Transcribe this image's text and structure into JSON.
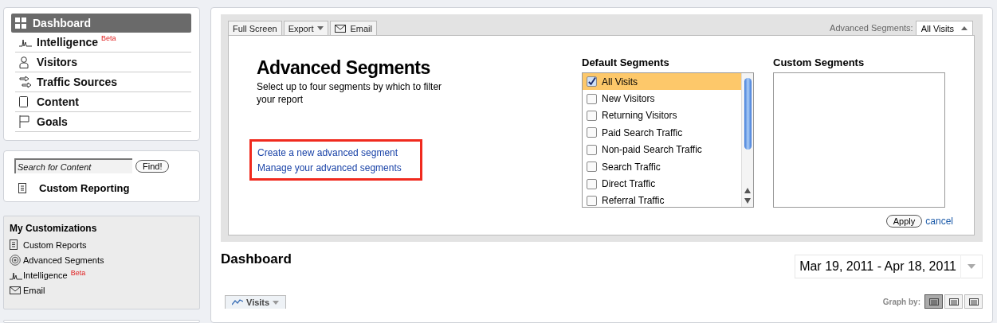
{
  "nav": [
    {
      "label": "Dashboard",
      "kind": "grid",
      "selected": true
    },
    {
      "label": "Intelligence",
      "kind": "spark",
      "badge": "Beta",
      "selected": false
    },
    {
      "label": "Visitors",
      "kind": "person",
      "selected": false
    },
    {
      "label": "Traffic Sources",
      "kind": "arrows",
      "selected": false
    },
    {
      "label": "Content",
      "kind": "page",
      "selected": false
    },
    {
      "label": "Goals",
      "kind": "flag",
      "selected": false
    }
  ],
  "search": {
    "placeholder": "Search for Content",
    "button": "Find!",
    "custom_reporting": "Custom Reporting"
  },
  "customizations": {
    "title": "My Customizations",
    "items": [
      {
        "label": "Custom Reports",
        "kind": "report"
      },
      {
        "label": "Advanced Segments",
        "kind": "target"
      },
      {
        "label": "Intelligence",
        "kind": "spark",
        "badge": "Beta"
      },
      {
        "label": "Email",
        "kind": "mail"
      }
    ]
  },
  "toolbar": {
    "buttons": [
      {
        "label": "Full Screen",
        "kind": "plain"
      },
      {
        "label": "Export",
        "kind": "menu"
      },
      {
        "label": "Email",
        "kind": "mail"
      }
    ],
    "segments_label": "Advanced Segments:",
    "segments_value": "All Visits"
  },
  "segments": {
    "title": "Advanced Segments",
    "description": "Select up to four segments by which to filter your report",
    "links": [
      "Create a new advanced segment",
      "Manage your advanced segments"
    ],
    "default_title": "Default Segments",
    "custom_title": "Custom Segments",
    "defaults": [
      {
        "label": "All Visits",
        "checked": true
      },
      {
        "label": "New Visitors",
        "checked": false
      },
      {
        "label": "Returning Visitors",
        "checked": false
      },
      {
        "label": "Paid Search Traffic",
        "checked": false
      },
      {
        "label": "Non-paid Search Traffic",
        "checked": false
      },
      {
        "label": "Search Traffic",
        "checked": false
      },
      {
        "label": "Direct Traffic",
        "checked": false
      },
      {
        "label": "Referral Traffic",
        "checked": false
      }
    ],
    "apply": "Apply",
    "cancel": "cancel"
  },
  "dashboard": {
    "title": "Dashboard",
    "date_range": "Mar 19, 2011 - Apr 18, 2011",
    "metric_tab": "Visits",
    "graph_by_label": "Graph by:",
    "graph_by": [
      {
        "selected": true
      },
      {
        "selected": false
      },
      {
        "selected": false
      }
    ]
  }
}
